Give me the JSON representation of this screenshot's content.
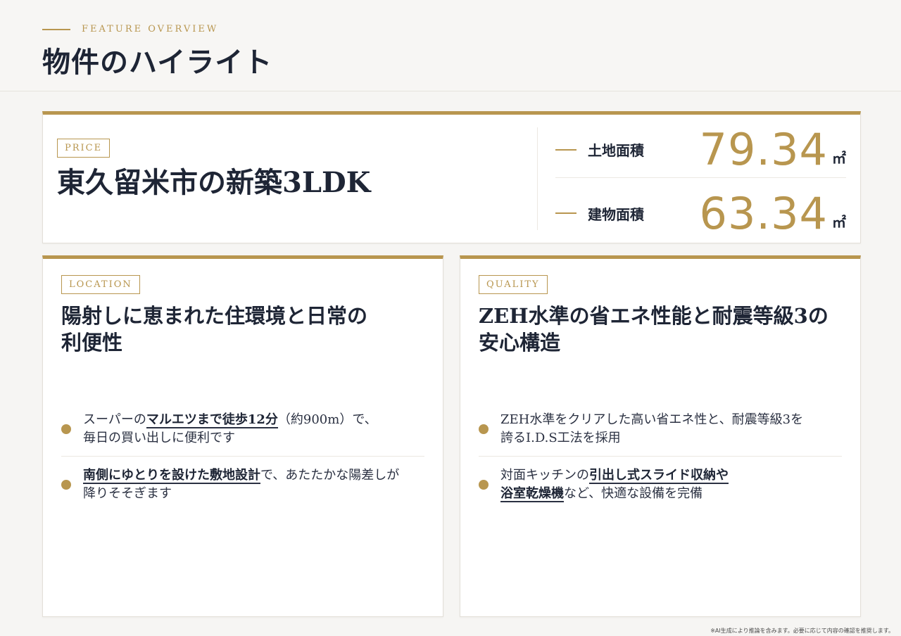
{
  "header": {
    "eyebrow": "FEATURE OVERVIEW",
    "title": "物件のハイライト"
  },
  "price": {
    "tag": "PRICE",
    "title": "東久留米市の新築3LDK",
    "areas": [
      {
        "label": "土地面積",
        "value": "79.34",
        "unit": "㎡"
      },
      {
        "label": "建物面積",
        "value": "63.34",
        "unit": "㎡"
      }
    ]
  },
  "location": {
    "tag": "LOCATION",
    "heading_line1": "陽射しに恵まれた住環境と日常の",
    "heading_line2": "利便性",
    "bullets": [
      {
        "pre": "スーパーの",
        "em": "マルエツまで徒歩12分",
        "post": "（約900m）で、",
        "line2": "毎日の買い出しに便利です"
      },
      {
        "em": "南側にゆとりを設けた敷地設計",
        "post": "で、あたたかな陽差しが",
        "line2": "降りそそぎます"
      }
    ]
  },
  "quality": {
    "tag": "QUALITY",
    "heading_line1": "ZEH水準の省エネ性能と耐震等級3の",
    "heading_line2": "安心構造",
    "bullets": [
      {
        "line1": "ZEH水準をクリアした高い省エネ性と、耐震等級3を",
        "line2": "誇るI.D.S工法を採用"
      },
      {
        "pre": "対面キッチンの",
        "em1": "引出し式スライド収納や",
        "em2": "浴室乾燥機",
        "post": "など、快適な設備を完備"
      }
    ]
  },
  "footnote": "※AI生成により推論を含みます。必要に応じて内容の確認を推奨します。",
  "colors": {
    "accent": "#b8964f",
    "text": "#1e2535",
    "background": "#f6f5f3"
  }
}
